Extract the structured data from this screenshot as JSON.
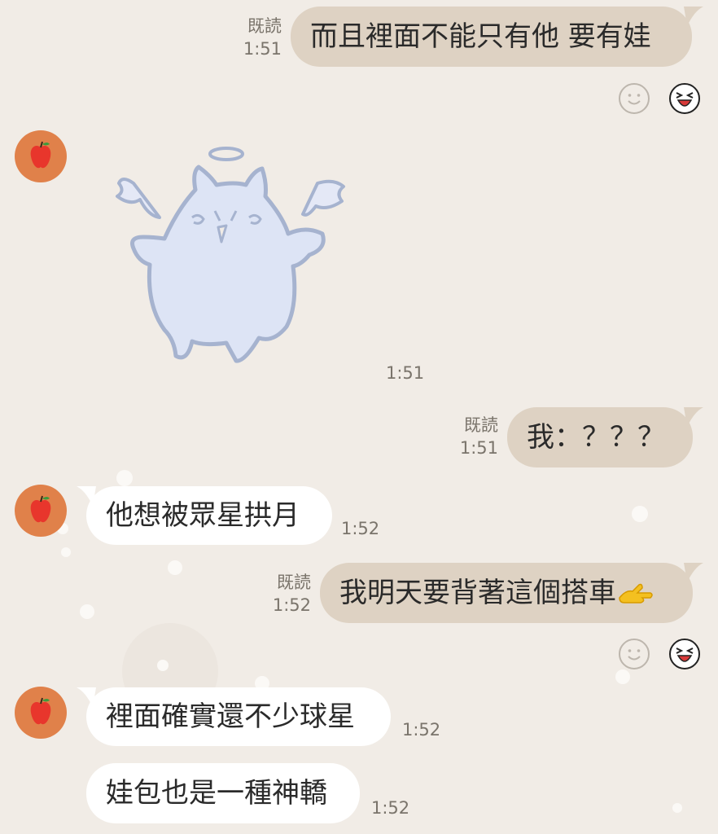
{
  "messages": {
    "m1": {
      "text": "而且裡面不能只有他 要有娃",
      "read": "既読",
      "time": "1:51"
    },
    "m2": {
      "time": "1:51"
    },
    "m3": {
      "text": "我：？？？",
      "read": "既読",
      "time": "1:51"
    },
    "m4": {
      "text": "他想被眾星拱月",
      "time": "1:52"
    },
    "m5": {
      "text": "我明天要背著這個搭車",
      "read": "既読",
      "time": "1:52"
    },
    "m6": {
      "text": "裡面確實還不少球星",
      "time": "1:52"
    },
    "m7": {
      "text": "娃包也是一種神轎",
      "time": "1:52"
    }
  },
  "icons": {
    "avatar": "apple-icon",
    "reaction": "smiley-face-icon",
    "reaction_sticker": "laughing-face-icon",
    "sticker": "angel-cat-sticker",
    "emoji": "flexed-hand-emoji"
  },
  "colors": {
    "background": "#f1ece6",
    "my_bubble": "#ded2c3",
    "their_bubble": "#ffffff",
    "avatar_bg": "#e0814a"
  }
}
